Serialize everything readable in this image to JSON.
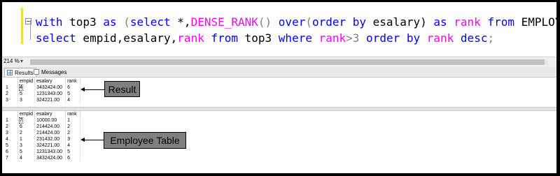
{
  "editor": {
    "line1": {
      "kw_with": "with",
      "t1": " top3 ",
      "kw_as": "as",
      "t2": " (",
      "kw_select": "select",
      "t3": " *,",
      "fn_dense": "DENSE_RANK",
      "t4": "() ",
      "kw_over": "over",
      "t5": "(",
      "kw_orderby": "order by",
      "t6": " esalary) ",
      "kw_as2": "as",
      "t7": " ",
      "kw_rank": "rank",
      "t8": " ",
      "kw_from": "from",
      "t9": " EMPLOYEE)"
    },
    "line2": {
      "kw_select": "select",
      "t1": " empid,esalary,",
      "kw_rank": "rank",
      "t2": " ",
      "kw_from": "from",
      "t3": " top3 ",
      "kw_where": "where",
      "t4": " ",
      "kw_rank2": "rank",
      "t5": ">3 ",
      "kw_orderby": "order by",
      "t6": " ",
      "kw_rank3": "rank",
      "t7": " ",
      "kw_desc": "desc",
      "t8": ";"
    }
  },
  "zoom": {
    "label": "214 %",
    "arrow": "▾"
  },
  "tabs": {
    "results": "Results",
    "messages": "Messages"
  },
  "result_grid": {
    "headers": [
      "empid",
      "esalary",
      "rank"
    ],
    "rows": [
      {
        "n": "1",
        "empid": "4",
        "esalary": "3432424.00",
        "rank": "6"
      },
      {
        "n": "2",
        "empid": "5",
        "esalary": "1231343.00",
        "rank": "5"
      },
      {
        "n": "3",
        "empid": "3",
        "esalary": "324221.00",
        "rank": "4"
      }
    ]
  },
  "employee_grid": {
    "headers": [
      "empid",
      "esalary",
      "rank"
    ],
    "rows": [
      {
        "n": "1",
        "empid": "7",
        "esalary": "10000.00",
        "rank": "1"
      },
      {
        "n": "2",
        "empid": "6",
        "esalary": "214424.00",
        "rank": "2"
      },
      {
        "n": "3",
        "empid": "2",
        "esalary": "214424.00",
        "rank": "2"
      },
      {
        "n": "4",
        "empid": "1",
        "esalary": "231432.00",
        "rank": "3"
      },
      {
        "n": "5",
        "empid": "3",
        "esalary": "324221.00",
        "rank": "4"
      },
      {
        "n": "6",
        "empid": "5",
        "esalary": "1231343.00",
        "rank": "5"
      },
      {
        "n": "7",
        "empid": "4",
        "esalary": "3432424.00",
        "rank": "6"
      }
    ]
  },
  "callouts": {
    "result": "Result",
    "employee": "Employee Table"
  },
  "colors": {
    "keyword": "#0000ff",
    "function": "#ff00ff",
    "callout_bg": "#808080"
  }
}
